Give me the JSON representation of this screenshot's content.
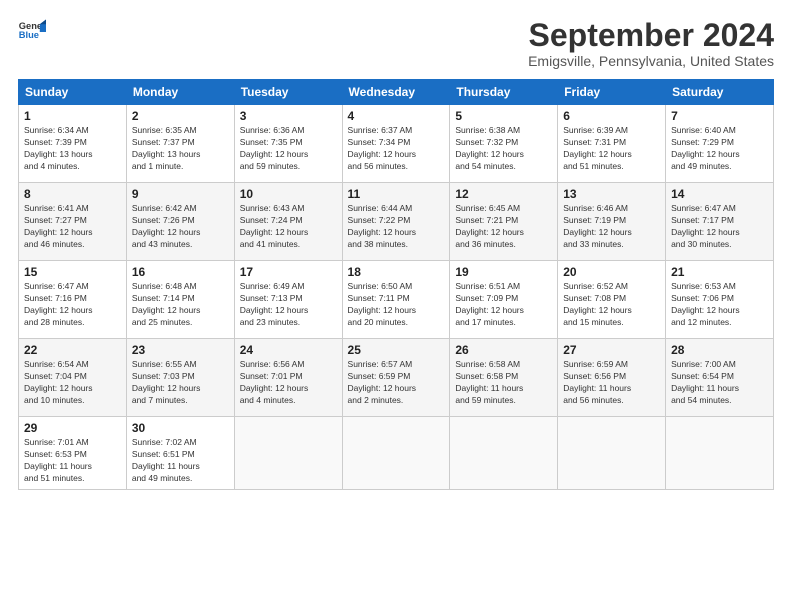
{
  "header": {
    "logo_line1": "General",
    "logo_line2": "Blue",
    "month": "September 2024",
    "location": "Emigsville, Pennsylvania, United States"
  },
  "weekdays": [
    "Sunday",
    "Monday",
    "Tuesday",
    "Wednesday",
    "Thursday",
    "Friday",
    "Saturday"
  ],
  "weeks": [
    [
      {
        "day": "1",
        "info": "Sunrise: 6:34 AM\nSunset: 7:39 PM\nDaylight: 13 hours\nand 4 minutes."
      },
      {
        "day": "2",
        "info": "Sunrise: 6:35 AM\nSunset: 7:37 PM\nDaylight: 13 hours\nand 1 minute."
      },
      {
        "day": "3",
        "info": "Sunrise: 6:36 AM\nSunset: 7:35 PM\nDaylight: 12 hours\nand 59 minutes."
      },
      {
        "day": "4",
        "info": "Sunrise: 6:37 AM\nSunset: 7:34 PM\nDaylight: 12 hours\nand 56 minutes."
      },
      {
        "day": "5",
        "info": "Sunrise: 6:38 AM\nSunset: 7:32 PM\nDaylight: 12 hours\nand 54 minutes."
      },
      {
        "day": "6",
        "info": "Sunrise: 6:39 AM\nSunset: 7:31 PM\nDaylight: 12 hours\nand 51 minutes."
      },
      {
        "day": "7",
        "info": "Sunrise: 6:40 AM\nSunset: 7:29 PM\nDaylight: 12 hours\nand 49 minutes."
      }
    ],
    [
      {
        "day": "8",
        "info": "Sunrise: 6:41 AM\nSunset: 7:27 PM\nDaylight: 12 hours\nand 46 minutes."
      },
      {
        "day": "9",
        "info": "Sunrise: 6:42 AM\nSunset: 7:26 PM\nDaylight: 12 hours\nand 43 minutes."
      },
      {
        "day": "10",
        "info": "Sunrise: 6:43 AM\nSunset: 7:24 PM\nDaylight: 12 hours\nand 41 minutes."
      },
      {
        "day": "11",
        "info": "Sunrise: 6:44 AM\nSunset: 7:22 PM\nDaylight: 12 hours\nand 38 minutes."
      },
      {
        "day": "12",
        "info": "Sunrise: 6:45 AM\nSunset: 7:21 PM\nDaylight: 12 hours\nand 36 minutes."
      },
      {
        "day": "13",
        "info": "Sunrise: 6:46 AM\nSunset: 7:19 PM\nDaylight: 12 hours\nand 33 minutes."
      },
      {
        "day": "14",
        "info": "Sunrise: 6:47 AM\nSunset: 7:17 PM\nDaylight: 12 hours\nand 30 minutes."
      }
    ],
    [
      {
        "day": "15",
        "info": "Sunrise: 6:47 AM\nSunset: 7:16 PM\nDaylight: 12 hours\nand 28 minutes."
      },
      {
        "day": "16",
        "info": "Sunrise: 6:48 AM\nSunset: 7:14 PM\nDaylight: 12 hours\nand 25 minutes."
      },
      {
        "day": "17",
        "info": "Sunrise: 6:49 AM\nSunset: 7:13 PM\nDaylight: 12 hours\nand 23 minutes."
      },
      {
        "day": "18",
        "info": "Sunrise: 6:50 AM\nSunset: 7:11 PM\nDaylight: 12 hours\nand 20 minutes."
      },
      {
        "day": "19",
        "info": "Sunrise: 6:51 AM\nSunset: 7:09 PM\nDaylight: 12 hours\nand 17 minutes."
      },
      {
        "day": "20",
        "info": "Sunrise: 6:52 AM\nSunset: 7:08 PM\nDaylight: 12 hours\nand 15 minutes."
      },
      {
        "day": "21",
        "info": "Sunrise: 6:53 AM\nSunset: 7:06 PM\nDaylight: 12 hours\nand 12 minutes."
      }
    ],
    [
      {
        "day": "22",
        "info": "Sunrise: 6:54 AM\nSunset: 7:04 PM\nDaylight: 12 hours\nand 10 minutes."
      },
      {
        "day": "23",
        "info": "Sunrise: 6:55 AM\nSunset: 7:03 PM\nDaylight: 12 hours\nand 7 minutes."
      },
      {
        "day": "24",
        "info": "Sunrise: 6:56 AM\nSunset: 7:01 PM\nDaylight: 12 hours\nand 4 minutes."
      },
      {
        "day": "25",
        "info": "Sunrise: 6:57 AM\nSunset: 6:59 PM\nDaylight: 12 hours\nand 2 minutes."
      },
      {
        "day": "26",
        "info": "Sunrise: 6:58 AM\nSunset: 6:58 PM\nDaylight: 11 hours\nand 59 minutes."
      },
      {
        "day": "27",
        "info": "Sunrise: 6:59 AM\nSunset: 6:56 PM\nDaylight: 11 hours\nand 56 minutes."
      },
      {
        "day": "28",
        "info": "Sunrise: 7:00 AM\nSunset: 6:54 PM\nDaylight: 11 hours\nand 54 minutes."
      }
    ],
    [
      {
        "day": "29",
        "info": "Sunrise: 7:01 AM\nSunset: 6:53 PM\nDaylight: 11 hours\nand 51 minutes."
      },
      {
        "day": "30",
        "info": "Sunrise: 7:02 AM\nSunset: 6:51 PM\nDaylight: 11 hours\nand 49 minutes."
      },
      {
        "day": "",
        "info": ""
      },
      {
        "day": "",
        "info": ""
      },
      {
        "day": "",
        "info": ""
      },
      {
        "day": "",
        "info": ""
      },
      {
        "day": "",
        "info": ""
      }
    ]
  ]
}
